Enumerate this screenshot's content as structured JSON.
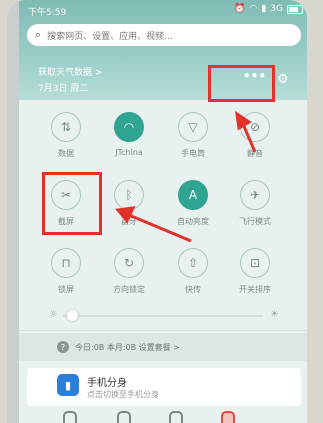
{
  "status": {
    "time": "下午5:59",
    "network": "3G",
    "icons": [
      "alarm-icon",
      "wifi-icon",
      "signal-icon",
      "battery-icon"
    ]
  },
  "search": {
    "placeholder": "搜索网页、设置、应用、视频..."
  },
  "weather": {
    "line1": "获取天气数据 >",
    "line2": "7月3日 周二"
  },
  "header": {
    "more": "•••"
  },
  "tiles": [
    {
      "label": "数据",
      "icon": "data-arrows-icon",
      "on": false
    },
    {
      "label": "JTchina",
      "icon": "wifi-icon",
      "on": true
    },
    {
      "label": "手电筒",
      "icon": "flashlight-icon",
      "on": false
    },
    {
      "label": "静音",
      "icon": "mute-bell-icon",
      "on": false
    },
    {
      "label": "截屏",
      "icon": "screenshot-icon",
      "on": false
    },
    {
      "label": "蓝牙",
      "icon": "bluetooth-icon",
      "on": false
    },
    {
      "label": "自动亮度",
      "icon": "auto-brightness-icon",
      "on": true
    },
    {
      "label": "飞行模式",
      "icon": "airplane-icon",
      "on": false
    },
    {
      "label": "锁屏",
      "icon": "lock-icon",
      "on": false
    },
    {
      "label": "方向锁定",
      "icon": "rotation-lock-icon",
      "on": false
    },
    {
      "label": "快传",
      "icon": "quick-transfer-icon",
      "on": false
    },
    {
      "label": "开关排序",
      "icon": "sort-icon",
      "on": false
    }
  ],
  "brightness": {
    "level": 0.02
  },
  "usage": {
    "text": "今日:0B  本月:0B  设置套餐 >"
  },
  "card": {
    "title": "手机分身",
    "subtitle": "点击切换至手机分身",
    "icon_text": "▮"
  },
  "accent": "#2fa493",
  "highlight_color": "#e3322a"
}
